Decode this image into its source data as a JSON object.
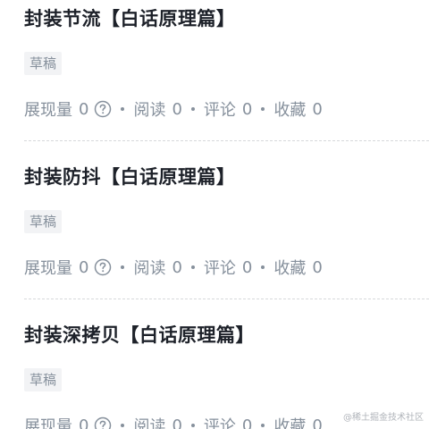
{
  "articles": [
    {
      "title": "封装节流【白话原理篇】",
      "badge": "草稿",
      "stats": {
        "views_label": "展现量",
        "views": "0",
        "reads_label": "阅读",
        "reads": "0",
        "comments_label": "评论",
        "comments": "0",
        "favorites_label": "收藏",
        "favorites": "0"
      }
    },
    {
      "title": "封装防抖【白话原理篇】",
      "badge": "草稿",
      "stats": {
        "views_label": "展现量",
        "views": "0",
        "reads_label": "阅读",
        "reads": "0",
        "comments_label": "评论",
        "comments": "0",
        "favorites_label": "收藏",
        "favorites": "0"
      }
    },
    {
      "title": "封装深拷贝【白话原理篇】",
      "badge": "草稿",
      "stats": {
        "views_label": "展现量",
        "views": "0",
        "reads_label": "阅读",
        "reads": "0",
        "comments_label": "评论",
        "comments": "0",
        "favorites_label": "收藏",
        "favorites": "0"
      }
    }
  ],
  "watermark": "@稀土掘金技术社区",
  "icons": {
    "help": "question-circle-icon"
  },
  "colors": {
    "title": "#1d2129",
    "muted": "#86909c",
    "badge_bg": "#f2f3f5"
  }
}
